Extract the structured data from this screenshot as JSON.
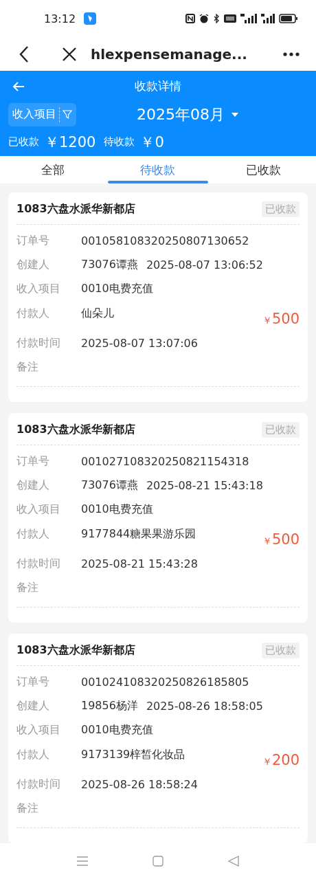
{
  "status_bar": {
    "time": "13:12"
  },
  "browser_bar": {
    "title": "hlexpensemanage..."
  },
  "header": {
    "title": "收款详情",
    "filter": {
      "label": "收入项目"
    },
    "month": "2025年08月",
    "stats": [
      {
        "label": "已收款",
        "value": "￥1200"
      },
      {
        "label": "待收款",
        "value": "￥0"
      }
    ]
  },
  "tabs": [
    {
      "label": "全部",
      "selected": false
    },
    {
      "label": "待收款",
      "selected": true
    },
    {
      "label": "已收款",
      "selected": false
    }
  ],
  "orders": [
    {
      "store": "1083六盘水派华新都店",
      "status": "已收款",
      "amount_symbol": "￥",
      "amount": "500",
      "rows": [
        {
          "kind": "field",
          "label": "订单号",
          "values": [
            "001058108320250807130652"
          ]
        },
        {
          "kind": "field",
          "label": "创建人",
          "values": [
            "73076谭燕",
            "2025-08-07 13:06:52"
          ]
        },
        {
          "kind": "field",
          "label": "收入项目",
          "values": [
            "0010电费充值"
          ]
        },
        {
          "kind": "payer",
          "label": "付款人",
          "values": [
            "仙朵儿"
          ]
        },
        {
          "kind": "field",
          "label": "付款时间",
          "values": [
            "2025-08-07 13:07:06"
          ]
        },
        {
          "kind": "field",
          "label": "备注"
        }
      ]
    },
    {
      "store": "1083六盘水派华新都店",
      "status": "已收款",
      "amount_symbol": "￥",
      "amount": "500",
      "rows": [
        {
          "kind": "field",
          "label": "订单号",
          "values": [
            "001027108320250821154318"
          ]
        },
        {
          "kind": "field",
          "label": "创建人",
          "values": [
            "73076谭燕",
            "2025-08-21 15:43:18"
          ]
        },
        {
          "kind": "field",
          "label": "收入项目",
          "values": [
            "0010电费充值"
          ]
        },
        {
          "kind": "payer",
          "label": "付款人",
          "values": [
            "9177844糖果果游乐园"
          ]
        },
        {
          "kind": "field",
          "label": "付款时间",
          "values": [
            "2025-08-21 15:43:28"
          ]
        },
        {
          "kind": "field",
          "label": "备注"
        }
      ]
    },
    {
      "store": "1083六盘水派华新都店",
      "status": "已收款",
      "amount_symbol": "￥",
      "amount": "200",
      "rows": [
        {
          "kind": "field",
          "label": "订单号",
          "values": [
            "001024108320250826185805"
          ]
        },
        {
          "kind": "field",
          "label": "创建人",
          "values": [
            "19856杨洋",
            "2025-08-26 18:58:05"
          ]
        },
        {
          "kind": "field",
          "label": "收入项目",
          "values": [
            "0010电费充值"
          ]
        },
        {
          "kind": "payer",
          "label": "付款人",
          "values": [
            "9173139梓皙化妆品"
          ]
        },
        {
          "kind": "field",
          "label": "付款时间",
          "values": [
            "2025-08-26 18:58:24"
          ]
        },
        {
          "kind": "field",
          "label": "备注"
        }
      ]
    }
  ]
}
